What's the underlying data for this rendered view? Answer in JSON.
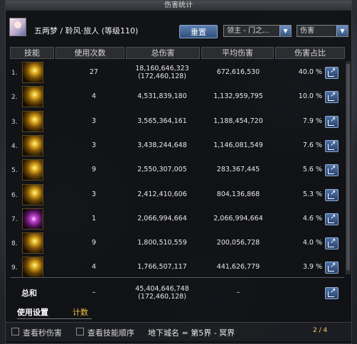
{
  "window": {
    "title": "伤害统计"
  },
  "header": {
    "character": "五两梦 / 聆风·旅人 (等级110)",
    "reset_label": "重置",
    "target_select": "领主 - 门之...",
    "type_select": "伤害"
  },
  "columns": {
    "skill": "技能",
    "count": "使用次数",
    "total": "总伤害",
    "avg": "平均伤害",
    "pct": "伤害占比"
  },
  "rows": [
    {
      "idx": "1.",
      "count": "27",
      "total": "18,160,646,323",
      "total_sub": "(172,460,128)",
      "avg": "672,616,530",
      "pct": "40.0 %"
    },
    {
      "idx": "2.",
      "count": "4",
      "total": "4,531,839,180",
      "total_sub": "",
      "avg": "1,132,959,795",
      "pct": "10.0 %"
    },
    {
      "idx": "3.",
      "count": "3",
      "total": "3,565,364,161",
      "total_sub": "",
      "avg": "1,188,454,720",
      "pct": "7.9 %"
    },
    {
      "idx": "4.",
      "count": "3",
      "total": "3,438,244,648",
      "total_sub": "",
      "avg": "1,146,081,549",
      "pct": "7.6 %"
    },
    {
      "idx": "5.",
      "count": "9",
      "total": "2,550,307,005",
      "total_sub": "",
      "avg": "283,367,445",
      "pct": "5.6 %"
    },
    {
      "idx": "6.",
      "count": "3",
      "total": "2,412,410,606",
      "total_sub": "",
      "avg": "804,136,868",
      "pct": "5.3 %"
    },
    {
      "idx": "7.",
      "count": "1",
      "total": "2,066,994,664",
      "total_sub": "",
      "avg": "2,066,994,664",
      "pct": "4.6 %"
    },
    {
      "idx": "8.",
      "count": "9",
      "total": "1,800,510,559",
      "total_sub": "",
      "avg": "200,056,728",
      "pct": "4.0 %"
    },
    {
      "idx": "9.",
      "count": "4",
      "total": "1,766,507,117",
      "total_sub": "",
      "avg": "441,626,779",
      "pct": "3.9 %"
    }
  ],
  "summary": {
    "label": "总和",
    "count": "–",
    "total": "45,404,646,748",
    "total_sub": "(172,460,128)",
    "avg": "–"
  },
  "tabs": {
    "settings": "使用设置",
    "count": "计数"
  },
  "bottom": {
    "check_sec": "查看秒伤害",
    "check_order": "查看技能顺序",
    "dungeon": "地下城名 = 第5界 - 冥界",
    "pager": "2 / 4"
  }
}
